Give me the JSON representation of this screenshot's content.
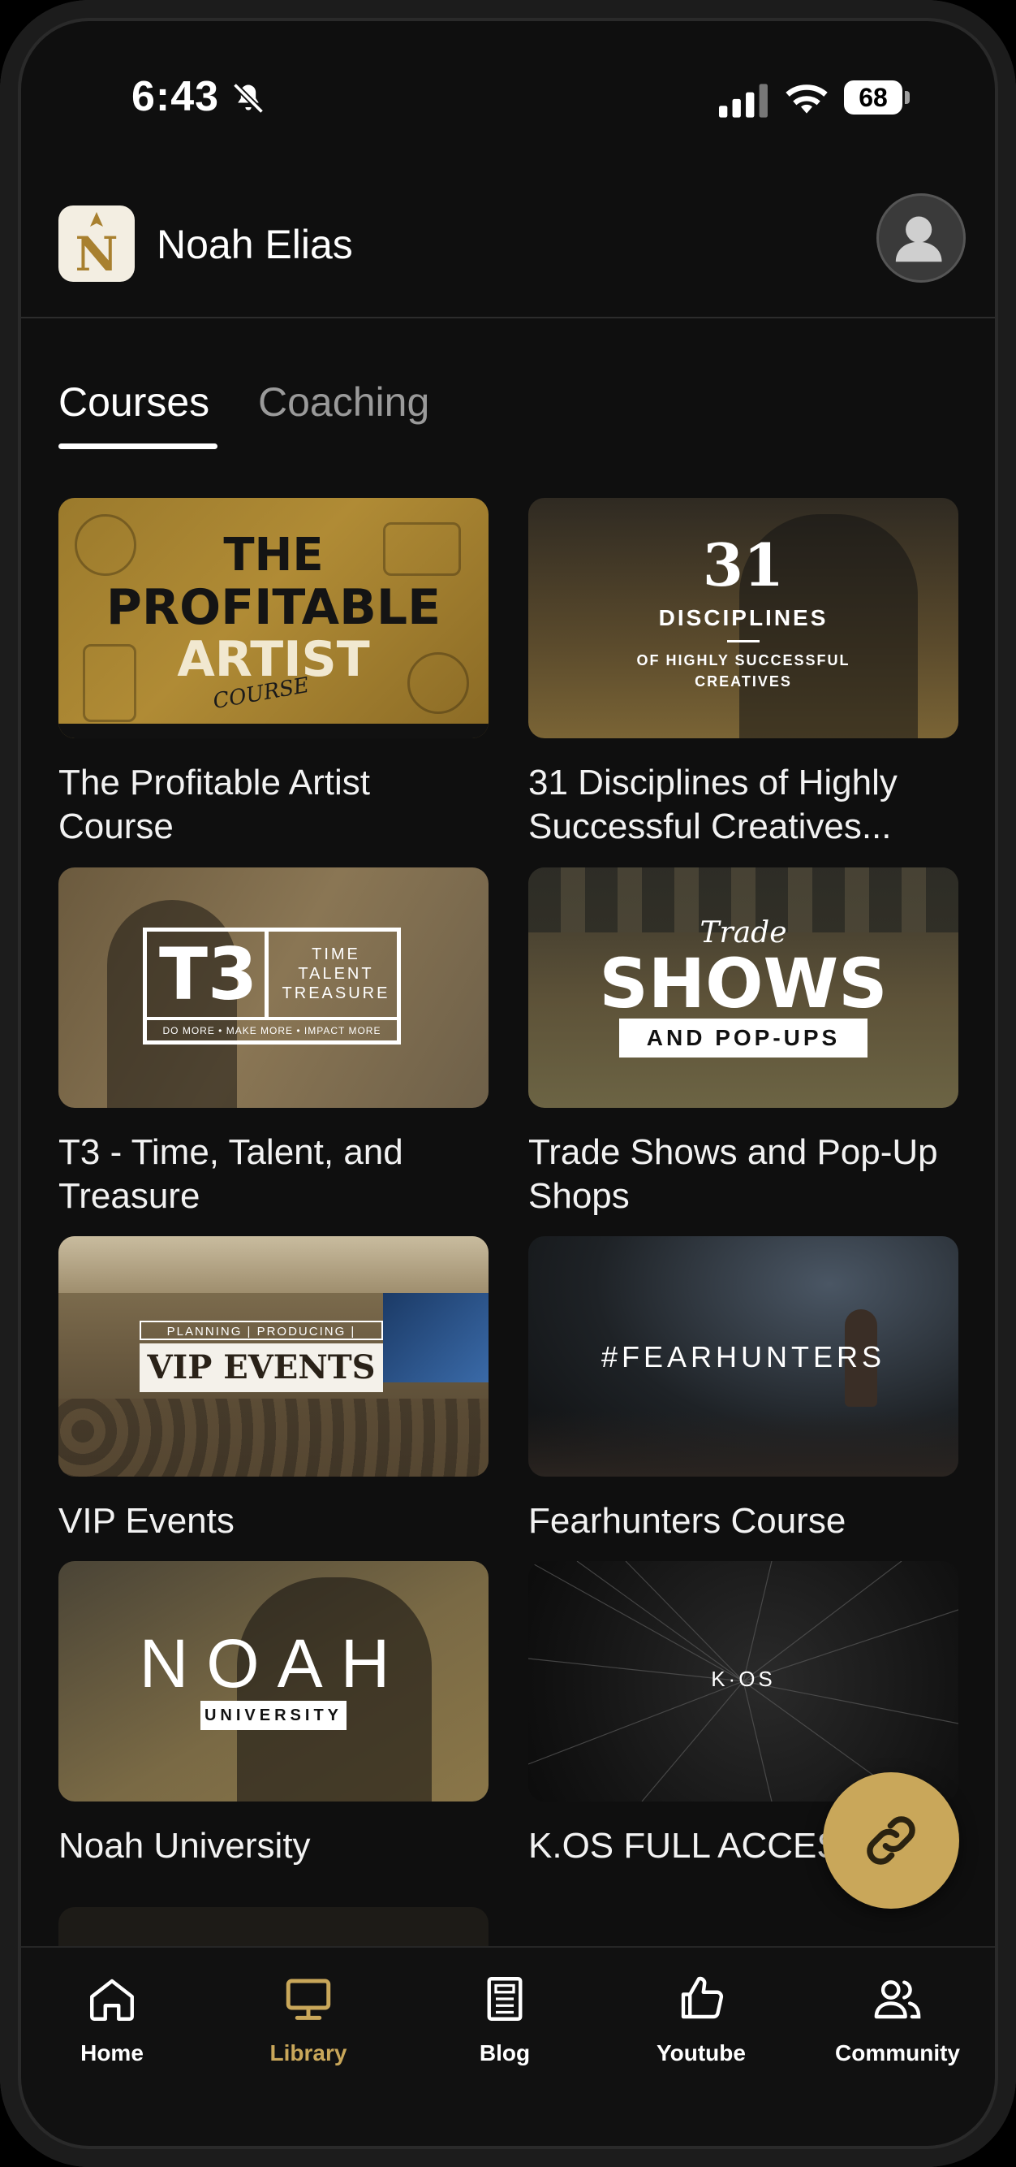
{
  "status_bar": {
    "time": "6:43",
    "battery": "68"
  },
  "header": {
    "owner_name": "Noah Elias"
  },
  "tabs": [
    {
      "label": "Courses",
      "active": true
    },
    {
      "label": "Coaching",
      "active": false
    }
  ],
  "courses": [
    {
      "title": "The Profitable Artist Course",
      "thumb_text": [
        "THE",
        "PROFITABLE",
        "ARTIST",
        "COURSE"
      ]
    },
    {
      "title": "31 Disciplines of Highly Successful Creatives...",
      "thumb_text": [
        "31",
        "DISCIPLINES",
        "OF HIGHLY SUCCESSFUL",
        "CREATIVES"
      ]
    },
    {
      "title": "T3 - Time, Talent, and Treasure",
      "thumb_text": [
        "T3",
        "TIME",
        "TALENT",
        "TREASURE",
        "DO MORE • MAKE MORE • IMPACT MORE"
      ]
    },
    {
      "title": "Trade Shows and Pop-Up Shops",
      "thumb_text": [
        "Trade",
        "SHOWS",
        "AND POP-UPS"
      ]
    },
    {
      "title": "VIP Events",
      "thumb_text": [
        "PLANNING | PRODUCING | HOSTING",
        "VIP EVENTS"
      ]
    },
    {
      "title": "Fearhunters Course",
      "thumb_text": [
        "#FEARHUNTERS"
      ]
    },
    {
      "title": "Noah University",
      "thumb_text": [
        "NOAH",
        "UNIVERSITY"
      ]
    },
    {
      "title": "K.OS FULL ACCESS",
      "thumb_text": [
        "K·OS"
      ]
    }
  ],
  "bottom_nav": [
    {
      "label": "Home",
      "icon": "home-icon",
      "active": false
    },
    {
      "label": "Library",
      "icon": "monitor-icon",
      "active": true
    },
    {
      "label": "Blog",
      "icon": "document-icon",
      "active": false
    },
    {
      "label": "Youtube",
      "icon": "thumbs-up-icon",
      "active": false
    },
    {
      "label": "Community",
      "icon": "people-icon",
      "active": false
    }
  ],
  "colors": {
    "accent": "#c9a75a",
    "background": "#0f0f0f",
    "text": "#ffffff",
    "muted": "#9a9a9a"
  }
}
